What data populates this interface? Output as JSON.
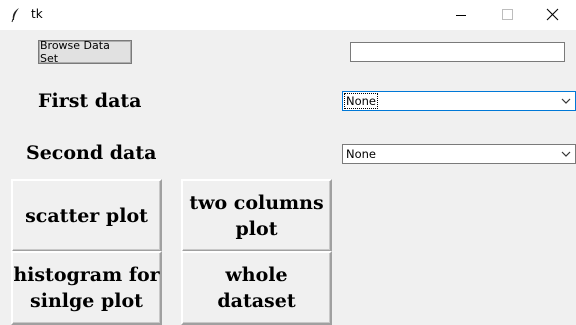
{
  "window": {
    "title": "tk"
  },
  "toolbar": {
    "browse_label": "Browse Data Set",
    "path_value": ""
  },
  "fields": {
    "first_label": "First data",
    "first_value": "None",
    "second_label": "Second data",
    "second_value": "None"
  },
  "buttons": {
    "scatter_label": "scatter plot",
    "two_columns_label": "two columns\nplot",
    "histogram_label": "histogram for\nsinlge plot",
    "whole_dataset_label": "whole\ndataset"
  },
  "icons": {
    "app": "feather-icon",
    "minimize": "minimize-icon",
    "maximize": "maximize-icon",
    "close": "close-icon",
    "dropdown": "chevron-down-icon"
  }
}
